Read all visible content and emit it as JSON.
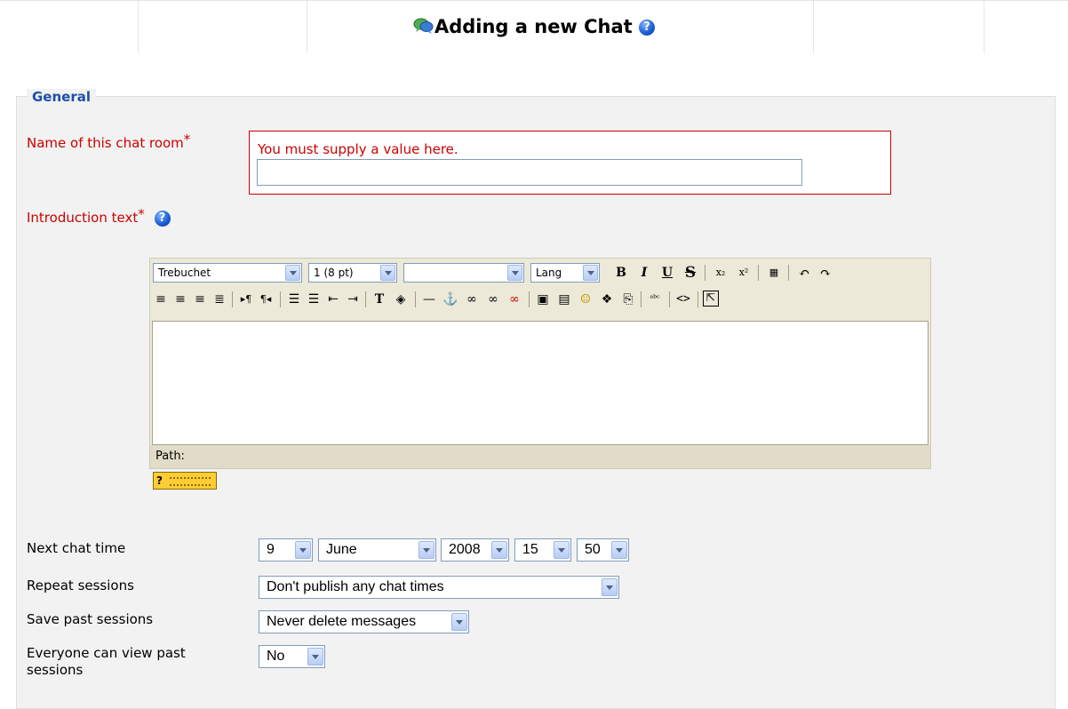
{
  "page": {
    "title": "Adding a new Chat"
  },
  "general": {
    "legend": "General",
    "name_label": "Name of this chat room",
    "required_mark": "*",
    "error_message": "You must supply a value here.",
    "name_value": "",
    "intro_label": "Introduction text"
  },
  "editor": {
    "font_family": "Trebuchet",
    "font_size": "1 (8 pt)",
    "style_select": "",
    "lang_select": "Lang",
    "bold": "B",
    "italic": "I",
    "underline": "U",
    "strike": "S",
    "path_label": "Path:",
    "keyboard_button": "?"
  },
  "schedule": {
    "next_chat_label": "Next chat time",
    "day": "9",
    "month": "June",
    "year": "2008",
    "hour": "15",
    "minute": "50",
    "repeat_label": "Repeat sessions",
    "repeat_value": "Don't publish any chat times",
    "save_label": "Save past sessions",
    "save_value": "Never delete messages",
    "view_label_line1": "Everyone can view past",
    "view_label_line2": "sessions",
    "view_value": "No"
  },
  "colors": {
    "error": "#cc0000",
    "legend": "#1f4ea8",
    "panel_bg": "#f2f2f2",
    "toolbar_bg": "#ece9d8"
  }
}
